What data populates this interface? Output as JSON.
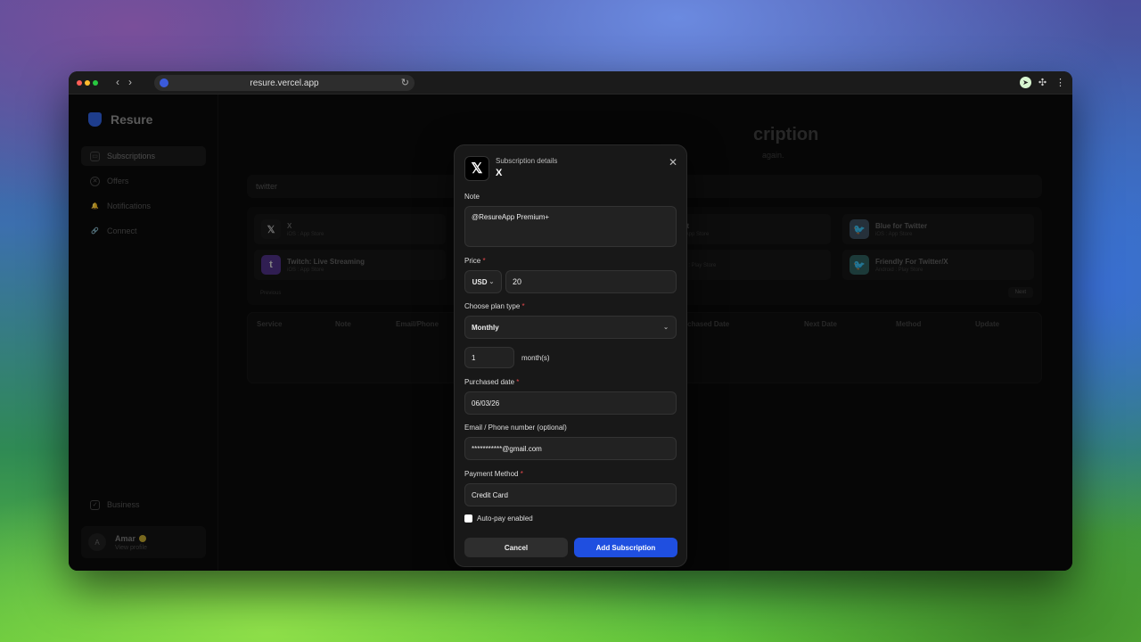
{
  "browser": {
    "url": "resure.vercel.app",
    "extensions": [
      "cursor-ext-icon",
      "puzzle-icon",
      "more-vertical-icon"
    ]
  },
  "sidebar": {
    "brand": "Resure",
    "items": [
      {
        "label": "Subscriptions",
        "icon": "inbox-icon",
        "active": true
      },
      {
        "label": "Offers",
        "icon": "offer-icon",
        "active": false
      },
      {
        "label": "Notifications",
        "icon": "bell-icon",
        "active": false
      },
      {
        "label": "Connect",
        "icon": "link-icon",
        "active": false
      }
    ],
    "business_label": "Business",
    "profile": {
      "initial": "A",
      "name": "Amar",
      "sub": "View profile"
    }
  },
  "background": {
    "title": "cription",
    "subtitle": "again.",
    "search_value": "twitter",
    "results": [
      {
        "name": "X",
        "sub": "iOS : App Store",
        "icon_text": "𝕏",
        "icon_bg": "#1a1a1a"
      },
      {
        "name": "Twitch: Live Streaming",
        "sub": "iOS : App Store",
        "icon_text": "t",
        "icon_bg": "#6441a5"
      },
      {
        "name": "eddit",
        "sub": "iOS : App Store",
        "icon_text": "",
        "icon_bg": "#141414"
      },
      {
        "name": "",
        "sub": "ndroid : Play Store",
        "icon_text": "",
        "icon_bg": "#141414"
      },
      {
        "name": "Blue for Twitter",
        "sub": "iOS : App Store",
        "icon_text": "🐦",
        "icon_bg": "#3a4a5a"
      },
      {
        "name": "Friendly For Twitter/X",
        "sub": "Android : Play Store",
        "icon_text": "🐦",
        "icon_bg": "#2c5a58"
      }
    ],
    "prev_label": "Previous",
    "next_label": "Next",
    "table_headers": [
      "Service",
      "Note",
      "Email/Phone",
      "rchased Date",
      "Next Date",
      "Method",
      "Update"
    ],
    "empty_text": "t."
  },
  "modal": {
    "kicker": "Subscription details",
    "title": "X",
    "logo": "𝕏",
    "note_label": "Note",
    "note_value": "@ResureApp Premium+",
    "price_label": "Price",
    "currency": "USD",
    "price_value": "20",
    "plan_label": "Choose plan type",
    "plan_value": "Monthly",
    "interval_value": "1",
    "interval_unit": "month(s)",
    "purchased_label": "Purchased date",
    "purchased_value": "06/03/26",
    "email_label": "Email / Phone number (optional)",
    "email_value": "***********@gmail.com",
    "payment_label": "Payment Method",
    "payment_value": "Credit Card",
    "autopay_label": "Auto-pay enabled",
    "cancel_label": "Cancel",
    "add_label": "Add Subscription",
    "accent": "#1f4fe0",
    "required_mark": "*"
  }
}
